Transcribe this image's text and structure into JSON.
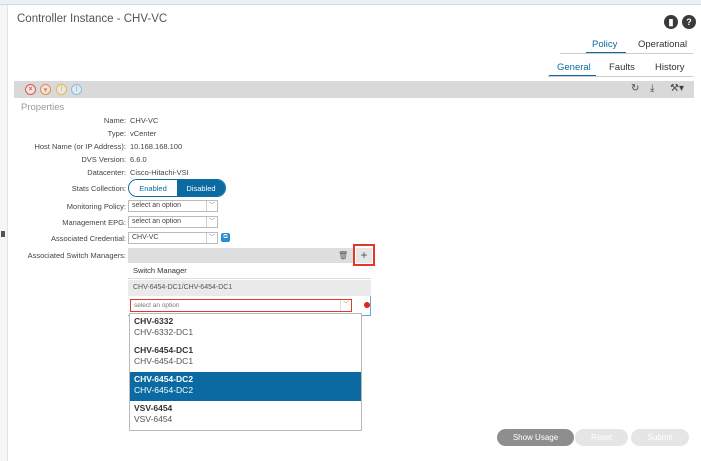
{
  "header": {
    "title": "Controller Instance - CHV-VC",
    "icons": [
      "bookmark-icon",
      "help-icon"
    ]
  },
  "tabs_primary": [
    {
      "label": "Policy",
      "active": true
    },
    {
      "label": "Operational",
      "active": false
    }
  ],
  "tabs_secondary": [
    {
      "label": "General",
      "active": true
    },
    {
      "label": "Faults",
      "active": false
    },
    {
      "label": "History",
      "active": false
    }
  ],
  "toolbar": {
    "status_icons": [
      {
        "name": "critical-fault-icon",
        "color": "#e0534a",
        "glyph": "×"
      },
      {
        "name": "major-fault-icon",
        "color": "#e88a4a",
        "glyph": "▾"
      },
      {
        "name": "minor-fault-icon",
        "color": "#e8b94a",
        "glyph": "!"
      },
      {
        "name": "warning-fault-icon",
        "color": "#7cc1e8",
        "glyph": "!"
      }
    ],
    "right_icons": [
      "refresh-icon",
      "download-icon",
      "tools-icon"
    ]
  },
  "properties": {
    "section_label": "Properties",
    "name": {
      "label": "Name:",
      "value": "CHV-VC"
    },
    "type": {
      "label": "Type:",
      "value": "vCenter"
    },
    "host": {
      "label": "Host Name (or IP Address):",
      "value": "10.168.168.100"
    },
    "dvs": {
      "label": "DVS Version:",
      "value": "6.6.0"
    },
    "datacenter": {
      "label": "Datacenter:",
      "value": "Cisco-Hitachi-VSI"
    },
    "stats": {
      "label": "Stats Collection:",
      "options": [
        "Enabled",
        "Disabled"
      ],
      "selected": "Disabled"
    },
    "monitoring": {
      "label": "Monitoring Policy:",
      "value": "select an option"
    },
    "mgmt_epg": {
      "label": "Management EPG:",
      "value": "select an option"
    },
    "credential": {
      "label": "Associated Credential:",
      "value": "CHV-VC"
    },
    "switch_managers": {
      "label": "Associated Switch Managers:"
    }
  },
  "switch_manager_table": {
    "header": "Switch Manager",
    "rows": [
      "CHV-6454-DC1/CHV-6454-DC1"
    ],
    "new_field_placeholder": "select an option",
    "options": [
      {
        "main": "CHV-6332",
        "sub": "CHV-6332-DC1",
        "selected": false
      },
      {
        "main": "CHV-6454-DC1",
        "sub": "CHV-6454-DC1",
        "selected": false
      },
      {
        "main": "CHV-6454-DC2",
        "sub": "CHV-6454-DC2",
        "selected": true
      },
      {
        "main": "VSV-6454",
        "sub": "VSV-6454",
        "selected": false
      }
    ]
  },
  "footer": {
    "show_usage": "Show Usage",
    "reset": "Reset",
    "submit": "Submit"
  },
  "colors": {
    "accent": "#0a6aa1",
    "highlight_border": "#e0382a"
  }
}
